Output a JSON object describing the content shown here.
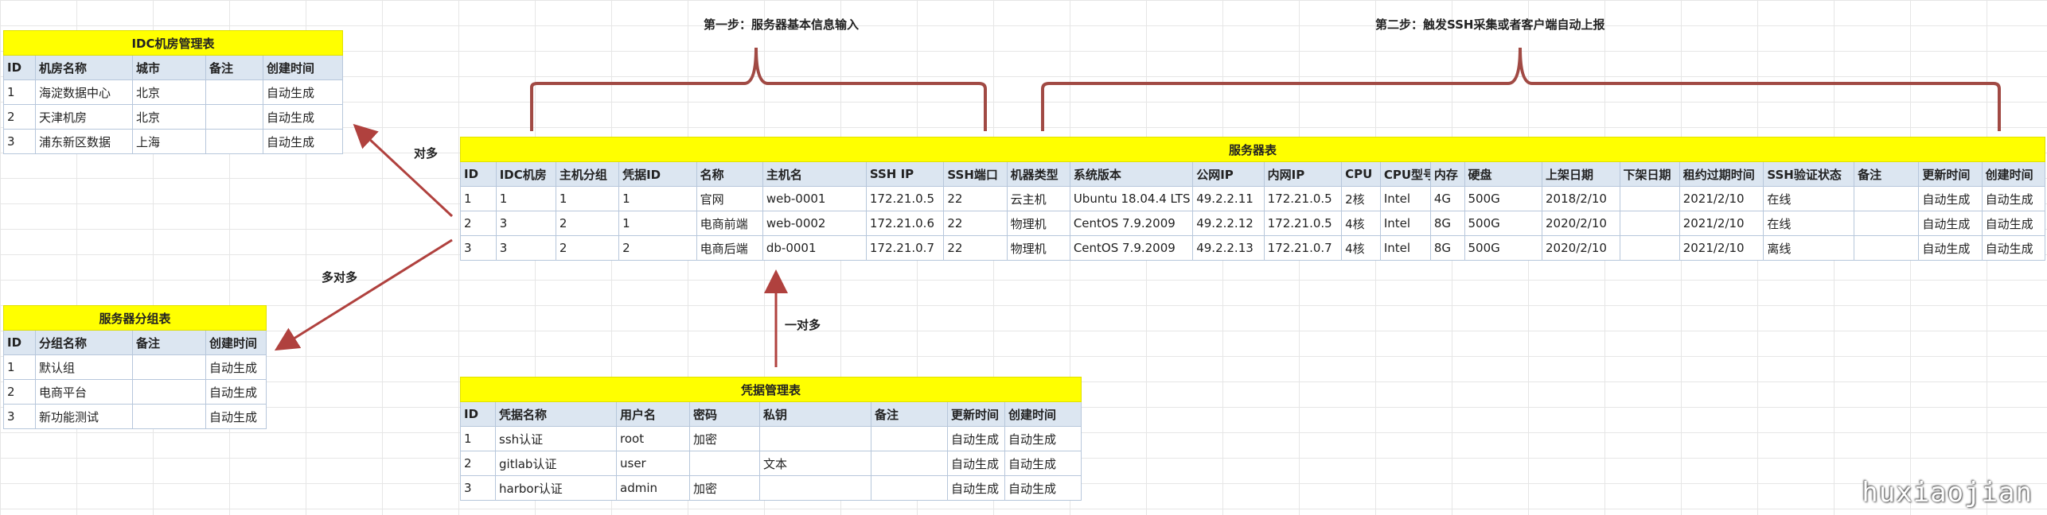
{
  "idc_table": {
    "title": "IDC机房管理表",
    "headers": [
      "ID",
      "机房名称",
      "城市",
      "备注",
      "创建时间"
    ],
    "rows": [
      [
        "1",
        "海淀数据中心",
        "北京",
        "",
        "自动生成"
      ],
      [
        "2",
        "天津机房",
        "北京",
        "",
        "自动生成"
      ],
      [
        "3",
        "浦东新区数据",
        "上海",
        "",
        "自动生成"
      ]
    ]
  },
  "group_table": {
    "title": "服务器分组表",
    "headers": [
      "ID",
      "分组名称",
      "备注",
      "创建时间"
    ],
    "rows": [
      [
        "1",
        "默认组",
        "",
        "自动生成"
      ],
      [
        "2",
        "电商平台",
        "",
        "自动生成"
      ],
      [
        "3",
        "新功能测试",
        "",
        "自动生成"
      ]
    ]
  },
  "server_table": {
    "title": "服务器表",
    "headers": [
      "ID",
      "IDC机房",
      "主机分组",
      "凭据ID",
      "名称",
      "主机名",
      "SSH IP",
      "SSH端口",
      "机器类型",
      "系统版本",
      "公网IP",
      "内网IP",
      "CPU",
      "CPU型号",
      "内存",
      "硬盘",
      "上架日期",
      "下架日期",
      "租约过期时间",
      "SSH验证状态",
      "备注",
      "更新时间",
      "创建时间"
    ],
    "rows": [
      [
        "1",
        "1",
        "1",
        "1",
        "官网",
        "web-0001",
        "172.21.0.5",
        "22",
        "云主机",
        "Ubuntu 18.04.4 LTS",
        "49.2.2.11",
        "172.21.0.5",
        "2核",
        "Intel",
        "4G",
        "500G",
        "2018/2/10",
        "",
        "2021/2/10",
        "在线",
        "",
        "自动生成",
        "自动生成"
      ],
      [
        "2",
        "3",
        "2",
        "1",
        "电商前端",
        "web-0002",
        "172.21.0.6",
        "22",
        "物理机",
        "CentOS 7.9.2009",
        "49.2.2.12",
        "172.21.0.5",
        "4核",
        "Intel",
        "8G",
        "500G",
        "2020/2/10",
        "",
        "2021/2/10",
        "在线",
        "",
        "自动生成",
        "自动生成"
      ],
      [
        "3",
        "3",
        "2",
        "2",
        "电商后端",
        "db-0001",
        "172.21.0.7",
        "22",
        "物理机",
        "CentOS 7.9.2009",
        "49.2.2.13",
        "172.21.0.7",
        "4核",
        "Intel",
        "8G",
        "500G",
        "2020/2/10",
        "",
        "2021/2/10",
        "离线",
        "",
        "自动生成",
        "自动生成"
      ]
    ]
  },
  "cred_table": {
    "title": "凭据管理表",
    "headers": [
      "ID",
      "凭据名称",
      "用户名",
      "密码",
      "私钥",
      "备注",
      "更新时间",
      "创建时间"
    ],
    "rows": [
      [
        "1",
        "ssh认证",
        "root",
        "加密",
        "",
        "",
        "自动生成",
        "自动生成"
      ],
      [
        "2",
        "gitlab认证",
        "user",
        "",
        "文本",
        "",
        "自动生成",
        "自动生成"
      ],
      [
        "3",
        "harbor认证",
        "admin",
        "加密",
        "",
        "",
        "自动生成",
        "自动生成"
      ]
    ]
  },
  "labels": {
    "step1": "第一步：服务器基本信息输入",
    "step2": "第二步：触发SSH采集或者客户端自动上报",
    "rel_idc": "对多",
    "rel_group": "多对多",
    "rel_cred": "一对多"
  },
  "watermark": "huxiaojian",
  "colors": {
    "title_fill": "#ffff00",
    "header_fill": "#dce6f1",
    "arrow": "#b0413e"
  }
}
